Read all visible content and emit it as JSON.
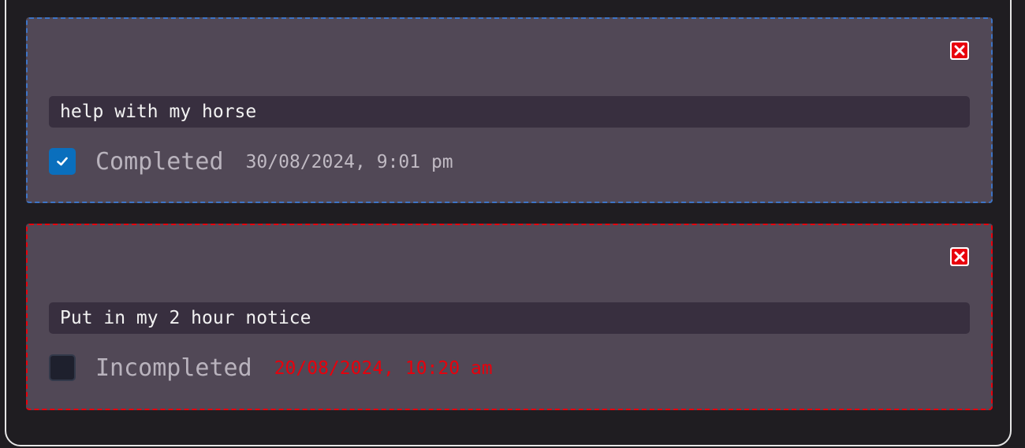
{
  "todos": [
    {
      "text": "help with my horse",
      "status_label": "Completed",
      "timestamp": "30/08/2024, 9:01 pm",
      "checked": true
    },
    {
      "text": "Put in my 2 hour notice",
      "status_label": "Incompleted",
      "timestamp": "20/08/2024, 10:20 am",
      "checked": false
    }
  ],
  "icons": {
    "delete": "close-icon",
    "check": "checkmark-icon"
  },
  "colors": {
    "background": "#1f1d21",
    "card": "#514856",
    "text_field": "#382f3f",
    "completed_border": "#3d74c6",
    "overdue_border": "#e8000c",
    "checkbox_checked": "#0a6fbd",
    "delete_red": "#e8000c"
  }
}
